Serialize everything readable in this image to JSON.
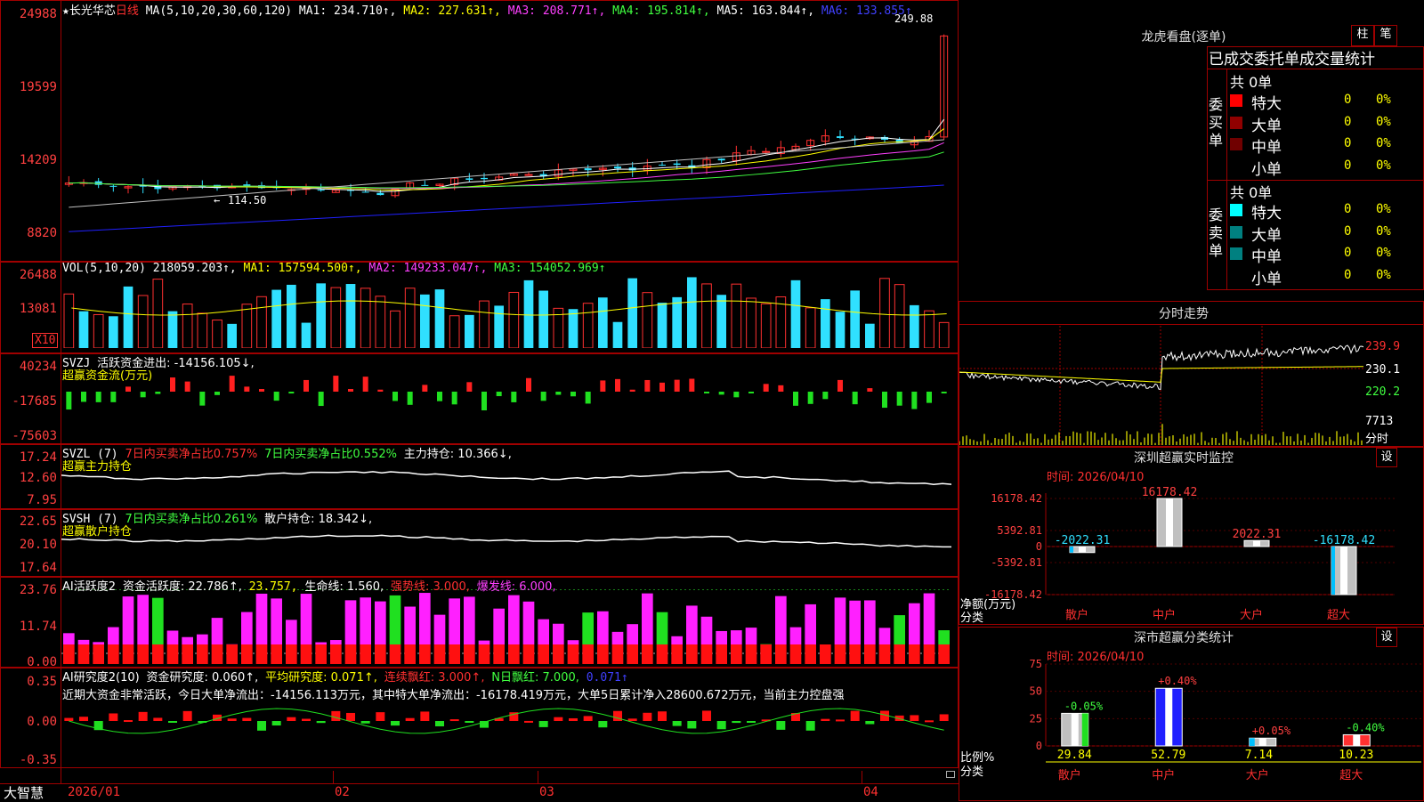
{
  "stock": {
    "star": "★",
    "name": "长光华芯",
    "period": "日线"
  },
  "ma_line": {
    "label": "MA(5,10,20,30,60,120)",
    "ma1": "MA1: 234.710↑,",
    "ma2": "MA2: 227.631↑,",
    "ma3": "MA3: 208.771↑,",
    "ma4": "MA4: 195.814↑,",
    "ma5": "MA5: 163.844↑,",
    "ma6": "MA6: 133.855↑"
  },
  "price_axis": [
    "24988",
    "19599",
    "14209",
    "8820"
  ],
  "price_high": "249.88",
  "price_low": "114.50",
  "vol": {
    "label": "VOL(5,10,20)",
    "value": "218059.203↑,",
    "ma1": "MA1: 157594.500↑,",
    "ma2": "MA2: 149233.047↑,",
    "ma3": "MA3: 154052.969↑",
    "axis": [
      "26488",
      "13081"
    ],
    "unit": "X10"
  },
  "svzj": {
    "label": "SVZJ",
    "text": "活跃资金进出: -14156.105↓,",
    "sub": "超赢资金流(万元)",
    "axis": [
      "40234",
      "-17685",
      "-75603"
    ]
  },
  "svzl": {
    "label": "SVZL (7)",
    "t1": "7日内买卖净占比0.757%",
    "t2": "7日内买卖净占比0.552%",
    "t3": "主力持仓: 10.366↓,",
    "sub": "超赢主力持仓",
    "axis": [
      "17.24",
      "12.60",
      "7.95"
    ]
  },
  "svsh": {
    "label": "SVSH (7)",
    "t1": "7日内买卖净占比0.261%",
    "t2": "散户持仓: 18.342↓,",
    "sub": "超赢散户持仓",
    "axis": [
      "22.65",
      "20.10",
      "17.64"
    ]
  },
  "ai1": {
    "label": "AI活跃度2",
    "t1": "资金活跃度: 22.786↑,",
    "t2": "23.757,",
    "t3": "生命线: 1.560,",
    "t4": "强势线: 3.000,",
    "t5": "爆发线: 6.000,",
    "axis": [
      "23.76",
      "11.74",
      "0.00"
    ]
  },
  "ai2": {
    "label": "AI研究度2(10)",
    "t1": "资金研究度: 0.060↑,",
    "t2": "平均研究度: 0.071↑,",
    "t3": "连续飘红: 3.000↑,",
    "t4": "N日飘红: 7.000,",
    "t5": "0.071↑",
    "comment": "近期大资金非常活跃，今日大单净流出：-14156.113万元，其中特大单净流出：-16178.419万元，大单5日累计净入28600.672万元，当前主力控盘强",
    "axis": [
      "0.35",
      "0.00",
      "-0.35"
    ]
  },
  "x_axis": [
    "2026/01",
    "02",
    "03",
    "04"
  ],
  "brand": "大智慧",
  "longhu": {
    "title": "龙虎看盘(逐单)",
    "btn1": "柱",
    "btn2": "笔",
    "header": "已成交委托单成交量统计",
    "buy_label": "委买单",
    "sell_label": "委卖单",
    "buy_total": "共 0单",
    "sell_total": "共 0单",
    "buy_rows": [
      {
        "name": "特大",
        "count": "0",
        "pct": "0%",
        "color": "#ff0000"
      },
      {
        "name": "大单",
        "count": "0",
        "pct": "0%",
        "color": "#900000"
      },
      {
        "name": "中单",
        "count": "0",
        "pct": "0%",
        "color": "#700000"
      },
      {
        "name": "小单",
        "count": "0",
        "pct": "0%",
        "color": ""
      }
    ],
    "sell_rows": [
      {
        "name": "特大",
        "count": "0",
        "pct": "0%",
        "color": "#00ffff"
      },
      {
        "name": "大单",
        "count": "0",
        "pct": "0%",
        "color": "#008080"
      },
      {
        "name": "中单",
        "count": "0",
        "pct": "0%",
        "color": "#008080"
      },
      {
        "name": "小单",
        "count": "0",
        "pct": "0%",
        "color": ""
      }
    ]
  },
  "fenshi": {
    "title": "分时走势",
    "axis": [
      "239.9",
      "230.1",
      "220.2"
    ],
    "vol_label": "7713",
    "vol_unit": "分时"
  },
  "monitor": {
    "title": "深圳超赢实时监控",
    "btn": "设",
    "date": "时间: 2026/04/10",
    "axis": [
      "16178.42",
      "5392.81",
      "0",
      "-5392.81",
      "-16178.42"
    ],
    "left_label_1": "净额(万元)",
    "left_label_2": "分类",
    "chart_data": {
      "type": "bar",
      "categories": [
        "散户",
        "中户",
        "大户",
        "超大"
      ],
      "values": [
        -2022.31,
        16178.42,
        2022.31,
        -16178.42
      ],
      "value_labels": [
        "-2022.31",
        "16178.42",
        "2022.31",
        "-16178.42"
      ],
      "ylim": [
        -16178.42,
        16178.42
      ]
    }
  },
  "classify": {
    "title": "深市超赢分类统计",
    "btn": "设",
    "date": "时间: 2026/04/10",
    "axis": [
      "75",
      "50",
      "25",
      "0"
    ],
    "left_label_1": "比例%",
    "left_label_2": "分类",
    "chart_data": {
      "type": "bar",
      "categories": [
        "散户",
        "中户",
        "大户",
        "超大"
      ],
      "values": [
        29.84,
        52.79,
        7.14,
        10.23
      ],
      "value_labels": [
        "29.84",
        "52.79",
        "7.14",
        "10.23"
      ],
      "change_labels": [
        "-0.05%",
        "+0.40%",
        "+0.05%",
        "-0.40%"
      ],
      "ylim": [
        0,
        75
      ]
    }
  }
}
